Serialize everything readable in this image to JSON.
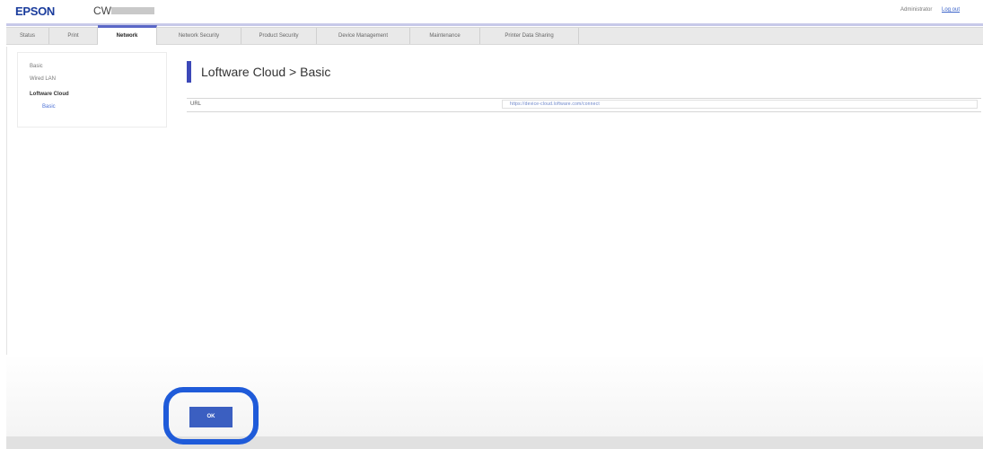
{
  "header": {
    "logo": "EPSON",
    "model": "CW-",
    "admin_label": "Administrator",
    "logout_label": "Log out"
  },
  "tabs": [
    {
      "label": "Status"
    },
    {
      "label": "Print"
    },
    {
      "label": "Network",
      "active": true
    },
    {
      "label": "Network Security"
    },
    {
      "label": "Product Security"
    },
    {
      "label": "Device Management"
    },
    {
      "label": "Maintenance"
    },
    {
      "label": "Printer Data Sharing"
    }
  ],
  "sidebar": {
    "items": [
      {
        "label": "Basic"
      },
      {
        "label": "Wired LAN"
      },
      {
        "label": "Loftware Cloud",
        "selected": true
      },
      {
        "label": "Basic",
        "sub": true
      }
    ]
  },
  "main": {
    "title": "Loftware Cloud > Basic",
    "url_label": "URL",
    "url_value": "https://device-cloud.loftware.com/connect"
  },
  "actions": {
    "ok_label": "OK"
  },
  "colors": {
    "accent": "#3c48b8",
    "button": "#3b5fc1",
    "highlight": "#1f5bd9"
  }
}
